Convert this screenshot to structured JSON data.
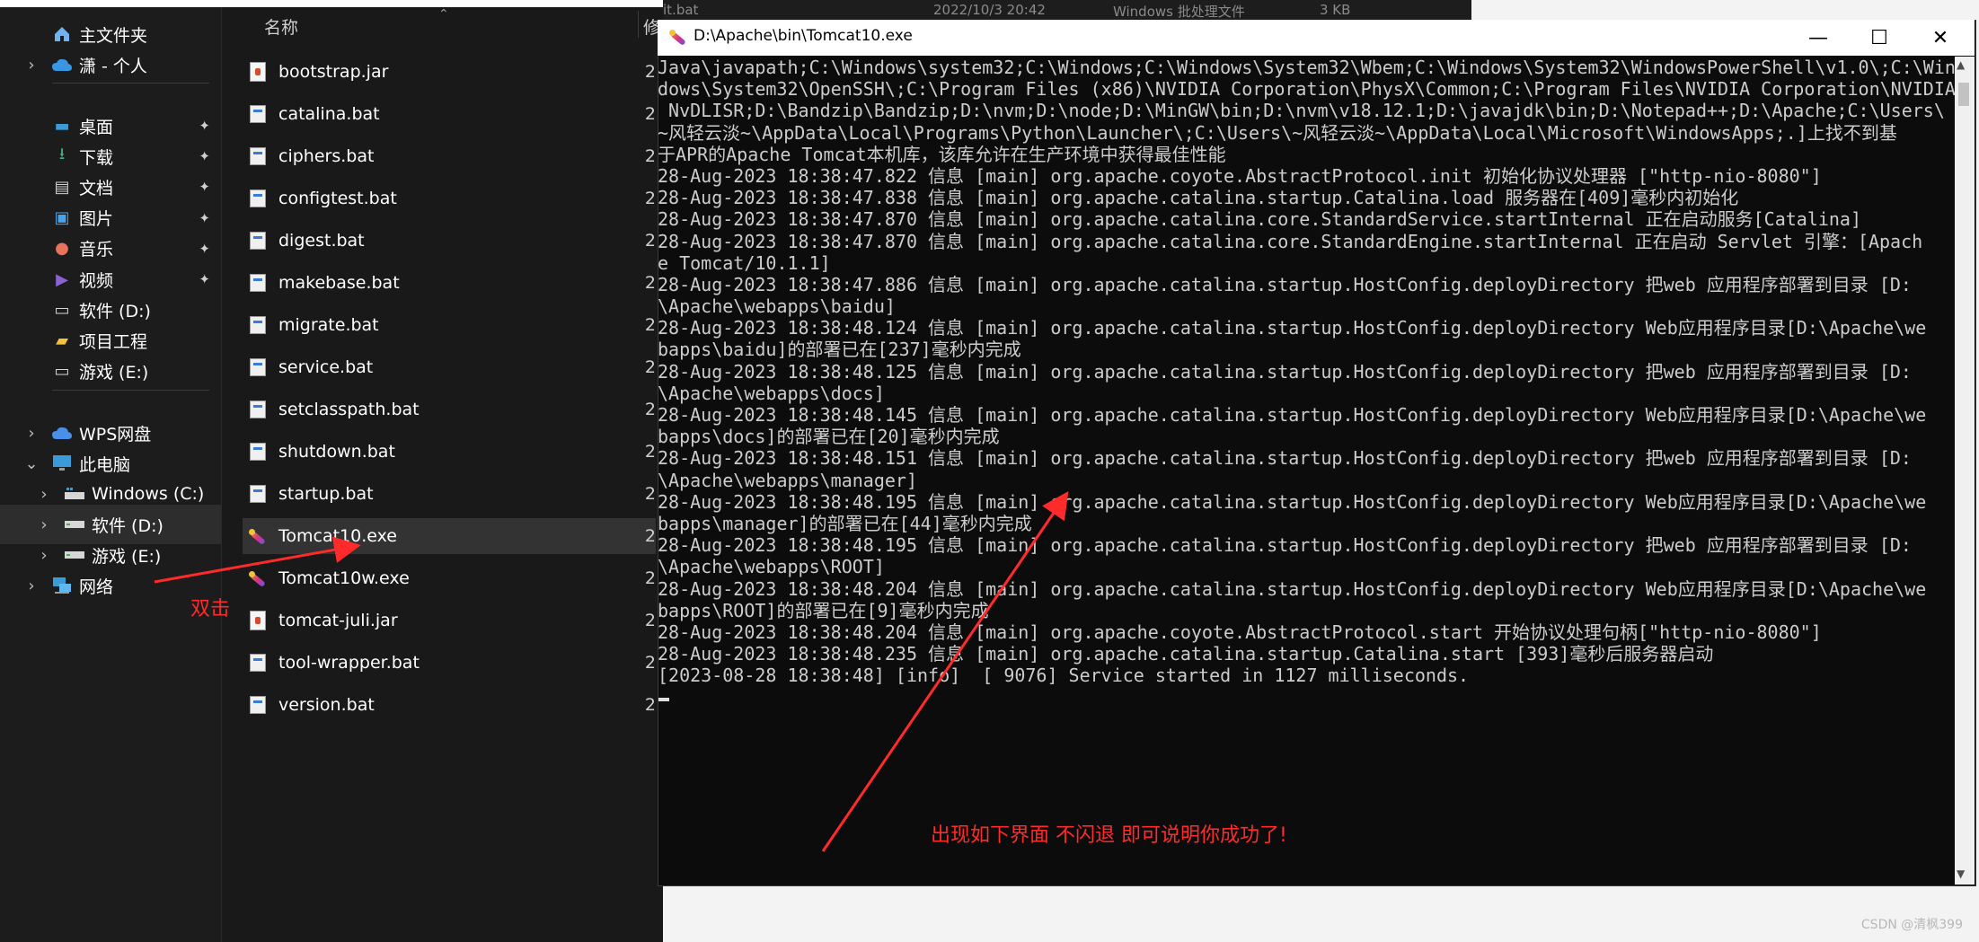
{
  "explorer": {
    "nav": {
      "home_label": "主文件夹",
      "onedrive_label": "潇 - 个人",
      "quick": [
        {
          "label": "桌面",
          "icon": "desktop-icon"
        },
        {
          "label": "下载",
          "icon": "download-icon"
        },
        {
          "label": "文档",
          "icon": "documents-icon"
        },
        {
          "label": "图片",
          "icon": "pictures-icon"
        },
        {
          "label": "音乐",
          "icon": "music-icon"
        },
        {
          "label": "视频",
          "icon": "videos-icon"
        },
        {
          "label": "软件 (D:)",
          "icon": "drive-icon"
        },
        {
          "label": "项目工程",
          "icon": "folder-icon"
        },
        {
          "label": "游戏 (E:)",
          "icon": "drive-icon"
        }
      ],
      "wps_label": "WPS网盘",
      "this_pc_label": "此电脑",
      "drives": [
        {
          "label": "Windows (C:)"
        },
        {
          "label": "软件 (D:)"
        },
        {
          "label": "游戏 (E:)"
        }
      ],
      "network_label": "网络"
    },
    "columns": {
      "name": "名称",
      "next": "修"
    },
    "files": [
      {
        "name": "bootstrap.jar",
        "type": "jar"
      },
      {
        "name": "catalina.bat",
        "type": "bat"
      },
      {
        "name": "ciphers.bat",
        "type": "bat"
      },
      {
        "name": "configtest.bat",
        "type": "bat"
      },
      {
        "name": "digest.bat",
        "type": "bat"
      },
      {
        "name": "makebase.bat",
        "type": "bat"
      },
      {
        "name": "migrate.bat",
        "type": "bat"
      },
      {
        "name": "service.bat",
        "type": "bat"
      },
      {
        "name": "setclasspath.bat",
        "type": "bat"
      },
      {
        "name": "shutdown.bat",
        "type": "bat"
      },
      {
        "name": "startup.bat",
        "type": "bat"
      },
      {
        "name": "Tomcat10.exe",
        "type": "exe"
      },
      {
        "name": "Tomcat10w.exe",
        "type": "exe"
      },
      {
        "name": "tomcat-juli.jar",
        "type": "jar"
      },
      {
        "name": "tool-wrapper.bat",
        "type": "bat"
      },
      {
        "name": "version.bat",
        "type": "bat"
      }
    ],
    "row_trail": "2",
    "selected_file": "Tomcat10.exe"
  },
  "background_window": {
    "name_fragment": "it.bat",
    "date": "2022/10/3 20:42",
    "type": "Windows 批处理文件",
    "size": "3 KB"
  },
  "console": {
    "title": "D:\\Apache\\bin\\Tomcat10.exe",
    "lines": [
      "Java\\javapath;C:\\Windows\\system32;C:\\Windows;C:\\Windows\\System32\\Wbem;C:\\Windows\\System32\\WindowsPowerShell\\v1.0\\;C:\\Win",
      "dows\\System32\\OpenSSH\\;C:\\Program Files (x86)\\NVIDIA Corporation\\PhysX\\Common;C:\\Program Files\\NVIDIA Corporation\\NVIDIA",
      " NvDLISR;D:\\Bandzip\\Bandzip;D:\\nvm;D:\\node;D:\\MinGW\\bin;D:\\nvm\\v18.12.1;D:\\javajdk\\bin;D:\\Notepad++;D:\\Apache;C:\\Users\\",
      "~风轻云淡~\\AppData\\Local\\Programs\\Python\\Launcher\\;C:\\Users\\~风轻云淡~\\AppData\\Local\\Microsoft\\WindowsApps;.]上找不到基",
      "于APR的Apache Tomcat本机库，该库允许在生产环境中获得最佳性能",
      "28-Aug-2023 18:38:47.822 信息 [main] org.apache.coyote.AbstractProtocol.init 初始化协议处理器 [\"http-nio-8080\"]",
      "28-Aug-2023 18:38:47.838 信息 [main] org.apache.catalina.startup.Catalina.load 服务器在[409]毫秒内初始化",
      "28-Aug-2023 18:38:47.870 信息 [main] org.apache.catalina.core.StandardService.startInternal 正在启动服务[Catalina]",
      "28-Aug-2023 18:38:47.870 信息 [main] org.apache.catalina.core.StandardEngine.startInternal 正在启动 Servlet 引擎：[Apach",
      "e Tomcat/10.1.1]",
      "28-Aug-2023 18:38:47.886 信息 [main] org.apache.catalina.startup.HostConfig.deployDirectory 把web 应用程序部署到目录 [D:",
      "\\Apache\\webapps\\baidu]",
      "28-Aug-2023 18:38:48.124 信息 [main] org.apache.catalina.startup.HostConfig.deployDirectory Web应用程序目录[D:\\Apache\\we",
      "bapps\\baidu]的部署已在[237]毫秒内完成",
      "28-Aug-2023 18:38:48.125 信息 [main] org.apache.catalina.startup.HostConfig.deployDirectory 把web 应用程序部署到目录 [D:",
      "\\Apache\\webapps\\docs]",
      "28-Aug-2023 18:38:48.145 信息 [main] org.apache.catalina.startup.HostConfig.deployDirectory Web应用程序目录[D:\\Apache\\we",
      "bapps\\docs]的部署已在[20]毫秒内完成",
      "28-Aug-2023 18:38:48.151 信息 [main] org.apache.catalina.startup.HostConfig.deployDirectory 把web 应用程序部署到目录 [D:",
      "\\Apache\\webapps\\manager]",
      "28-Aug-2023 18:38:48.195 信息 [main] org.apache.catalina.startup.HostConfig.deployDirectory Web应用程序目录[D:\\Apache\\we",
      "bapps\\manager]的部署已在[44]毫秒内完成",
      "28-Aug-2023 18:38:48.195 信息 [main] org.apache.catalina.startup.HostConfig.deployDirectory 把web 应用程序部署到目录 [D:",
      "\\Apache\\webapps\\ROOT]",
      "28-Aug-2023 18:38:48.204 信息 [main] org.apache.catalina.startup.HostConfig.deployDirectory Web应用程序目录[D:\\Apache\\we",
      "bapps\\ROOT]的部署已在[9]毫秒内完成",
      "28-Aug-2023 18:38:48.204 信息 [main] org.apache.coyote.AbstractProtocol.start 开始协议处理句柄[\"http-nio-8080\"]",
      "28-Aug-2023 18:38:48.235 信息 [main] org.apache.catalina.startup.Catalina.start [393]毫秒后服务器启动",
      "[2023-08-28 18:38:48] [info]  [ 9076] Service started in 1127 milliseconds."
    ],
    "controls": {
      "minimize": "—",
      "maximize": "☐",
      "close": "✕"
    }
  },
  "annotations": {
    "double_click_label": "双击",
    "success_label": "出现如下界面 不闪退 即可说明你成功了!",
    "arrow_color": "#ff2a2a"
  },
  "watermark": "CSDN @清枫399"
}
